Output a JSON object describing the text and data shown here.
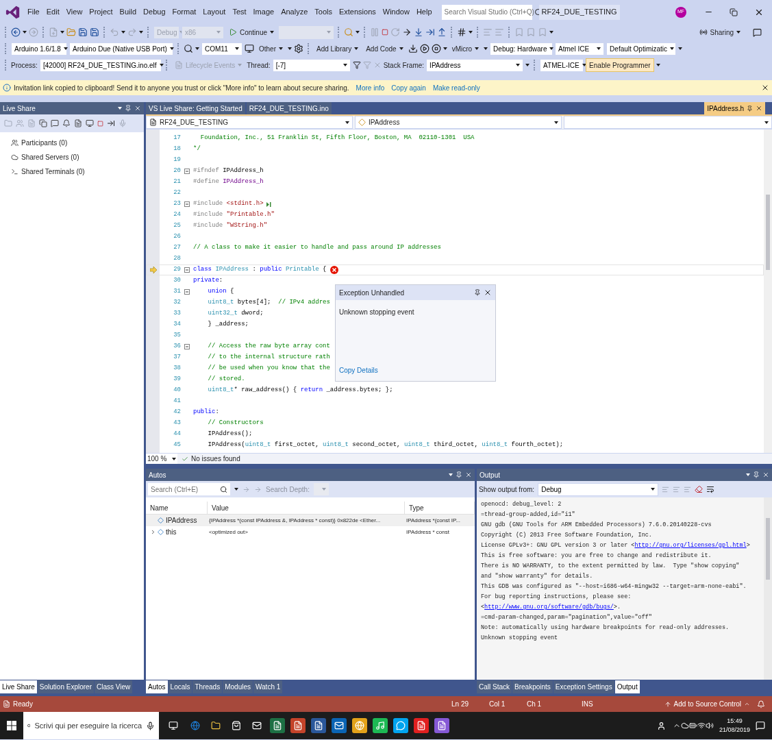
{
  "menu": {
    "items": [
      "File",
      "Edit",
      "View",
      "Project",
      "Build",
      "Debug",
      "Format",
      "Layout",
      "Test",
      "Image",
      "Analyze",
      "Tools",
      "Extensions",
      "Window",
      "Help"
    ],
    "search_placeholder": "Search Visual Studio (Ctrl+Q)",
    "solution_name": "RF24_DUE_TESTING",
    "avatar": "MF"
  },
  "toolbar_1": {
    "configuration": {
      "text": "Debug",
      "disabled": true
    },
    "platform": {
      "text": "x86",
      "disabled": true
    },
    "continue": "Continue",
    "sharing": "Sharing"
  },
  "toolbar_2": {
    "board_version": "Arduino 1.6/1.8",
    "board": "Arduino Due (Native USB Port)",
    "port": "COM11",
    "other": "Other",
    "add_library": "Add Library",
    "add_code": "Add Code",
    "vmicro": "vMicro",
    "debug_mode": "Debug: Hardware",
    "programmer": "Atmel ICE",
    "optimization": "Default Optimizatic"
  },
  "toolbar_3": {
    "process_label": "Process:",
    "process": "[42000] RF24_DUE_TESTING.ino.elf",
    "lifecycle_events": "Lifecycle Events",
    "thread_label": "Thread:",
    "thread": "[-7]",
    "stack_frame_label": "Stack Frame:",
    "stack_frame": "IPAddress",
    "debugger": "ATMEL-ICE",
    "enable_programmer": "Enable Programmer"
  },
  "info_bar": {
    "message": "Invitation link copied to clipboard! Send it to anyone you trust or click \"More info\" to learn about secure sharing.",
    "links": [
      "More info",
      "Copy again",
      "Make read-only"
    ]
  },
  "live_share": {
    "title": "Live Share",
    "items": [
      "Participants (0)",
      "Shared Servers (0)",
      "Shared Terminals (0)"
    ],
    "tabs": [
      {
        "label": "Live Share",
        "selected": true
      },
      {
        "label": "Solution Explorer",
        "selected": false
      },
      {
        "label": "Class View",
        "selected": false
      }
    ]
  },
  "editor": {
    "tabs": [
      {
        "label": "VS Live Share: Getting Started",
        "selected": false
      },
      {
        "label": "RF24_DUE_TESTING.ino",
        "selected": false
      },
      {
        "label": "IPAddress.h",
        "selected": true
      }
    ],
    "project_dropdown": "RF24_DUE_TESTING",
    "member_dropdown": "IPAddress",
    "lines": [
      {
        "number": "17",
        "fold": false,
        "current": false,
        "run_marker": false,
        "tokens": [
          {
            "text": "  Foundation, Inc., 51 Franklin St, Fifth Floor, Boston, MA  02110-1301  USA",
            "kind": "comment"
          }
        ]
      },
      {
        "number": "18",
        "fold": false,
        "current": false,
        "run_marker": false,
        "tokens": [
          {
            "text": "*/",
            "kind": "comment"
          }
        ]
      },
      {
        "number": "19",
        "fold": false,
        "current": false,
        "run_marker": false
      },
      {
        "number": "20",
        "fold": true,
        "current": false,
        "run_marker": false,
        "tokens": [
          {
            "text": "#ifndef",
            "kind": "preproc"
          },
          {
            "text": " IPAddress_h",
            "kind": "plain"
          }
        ]
      },
      {
        "number": "21",
        "fold": false,
        "current": false,
        "run_marker": false,
        "tokens": [
          {
            "text": "#define",
            "kind": "preproc"
          },
          {
            "text": " IPAddress_h",
            "kind": "macro"
          }
        ]
      },
      {
        "number": "22",
        "fold": false,
        "current": false,
        "run_marker": false
      },
      {
        "number": "23",
        "fold": true,
        "current": false,
        "run_marker": true,
        "tokens": [
          {
            "text": "#include",
            "kind": "preproc"
          },
          {
            "text": " <stdint.h>",
            "kind": "string"
          }
        ]
      },
      {
        "number": "24",
        "fold": false,
        "current": false,
        "run_marker": false,
        "tokens": [
          {
            "text": "#include",
            "kind": "preproc"
          },
          {
            "text": " \"Printable.h\"",
            "kind": "string"
          }
        ]
      },
      {
        "number": "25",
        "fold": false,
        "current": false,
        "run_marker": false,
        "tokens": [
          {
            "text": "#include",
            "kind": "preproc"
          },
          {
            "text": " \"WString.h\"",
            "kind": "string"
          }
        ]
      },
      {
        "number": "26",
        "fold": false,
        "current": false,
        "run_marker": false
      },
      {
        "number": "27",
        "fold": false,
        "current": false,
        "run_marker": false,
        "tokens": [
          {
            "text": "// A class to make it easier to handle and pass around IP addresses",
            "kind": "comment"
          }
        ]
      },
      {
        "number": "28",
        "fold": false,
        "current": false,
        "run_marker": false
      },
      {
        "number": "29",
        "fold": true,
        "current": true,
        "run_marker": false,
        "tokens": [
          {
            "text": "class",
            "kind": "keyword"
          },
          {
            "text": " IPAddress",
            "kind": "type"
          },
          {
            "text": " : ",
            "kind": "plain"
          },
          {
            "text": "public",
            "kind": "keyword"
          },
          {
            "text": " Printable",
            "kind": "type"
          },
          {
            "text": " {",
            "kind": "plain"
          }
        ]
      },
      {
        "number": "30",
        "fold": false,
        "current": false,
        "run_marker": false,
        "tokens": [
          {
            "text": "private",
            "kind": "keyword"
          },
          {
            "text": ":",
            "kind": "plain"
          }
        ]
      },
      {
        "number": "31",
        "fold": true,
        "current": false,
        "run_marker": false,
        "tokens": [
          {
            "text": "    union",
            "kind": "keyword"
          },
          {
            "text": " {",
            "kind": "plain"
          }
        ]
      },
      {
        "number": "32",
        "fold": false,
        "current": false,
        "run_marker": false,
        "tokens": [
          {
            "text": "    uint8_t",
            "kind": "type"
          },
          {
            "text": " bytes[4];  ",
            "kind": "plain"
          },
          {
            "text": "// IPv4 addres",
            "kind": "comment"
          }
        ]
      },
      {
        "number": "33",
        "fold": false,
        "current": false,
        "run_marker": false,
        "tokens": [
          {
            "text": "    uint32_t",
            "kind": "type"
          },
          {
            "text": " dword;",
            "kind": "plain"
          }
        ]
      },
      {
        "number": "34",
        "fold": false,
        "current": false,
        "run_marker": false,
        "tokens": [
          {
            "text": "    } _address;",
            "kind": "plain"
          }
        ]
      },
      {
        "number": "35",
        "fold": false,
        "current": false,
        "run_marker": false
      },
      {
        "number": "36",
        "fold": true,
        "current": false,
        "run_marker": false,
        "tokens": [
          {
            "text": "    // Access the raw byte array cont",
            "kind": "comment"
          }
        ]
      },
      {
        "number": "37",
        "fold": false,
        "current": false,
        "run_marker": false,
        "tokens": [
          {
            "text": "    // to the internal structure rath",
            "kind": "comment"
          }
        ]
      },
      {
        "number": "38",
        "fold": false,
        "current": false,
        "run_marker": false,
        "tokens": [
          {
            "text": "    // be used when you know that the",
            "kind": "comment"
          }
        ]
      },
      {
        "number": "39",
        "fold": false,
        "current": false,
        "run_marker": false,
        "tokens": [
          {
            "text": "    // stored.",
            "kind": "comment"
          }
        ]
      },
      {
        "number": "40",
        "fold": false,
        "current": false,
        "run_marker": false,
        "tokens": [
          {
            "text": "    uint8_t",
            "kind": "type"
          },
          {
            "text": "* raw_address() { ",
            "kind": "plain"
          },
          {
            "text": "return",
            "kind": "keyword"
          },
          {
            "text": " _address.bytes; };",
            "kind": "plain"
          }
        ]
      },
      {
        "number": "41",
        "fold": false,
        "current": false,
        "run_marker": false
      },
      {
        "number": "42",
        "fold": false,
        "current": false,
        "run_marker": false,
        "tokens": [
          {
            "text": "public",
            "kind": "keyword"
          },
          {
            "text": ":",
            "kind": "plain"
          }
        ]
      },
      {
        "number": "43",
        "fold": false,
        "current": false,
        "run_marker": false,
        "tokens": [
          {
            "text": "    // Constructors",
            "kind": "comment"
          }
        ]
      },
      {
        "number": "44",
        "fold": false,
        "current": false,
        "run_marker": false,
        "tokens": [
          {
            "text": "    IPAddress();",
            "kind": "plain"
          }
        ]
      },
      {
        "number": "45",
        "fold": false,
        "current": false,
        "run_marker": false,
        "tokens": [
          {
            "text": "    IPAddress(",
            "kind": "plain"
          },
          {
            "text": "uint8_t",
            "kind": "type"
          },
          {
            "text": " first_octet, ",
            "kind": "plain"
          },
          {
            "text": "uint8_t",
            "kind": "type"
          },
          {
            "text": " second_octet, ",
            "kind": "plain"
          },
          {
            "text": "uint8_t",
            "kind": "type"
          },
          {
            "text": " third_octet, ",
            "kind": "plain"
          },
          {
            "text": "uint8_t",
            "kind": "type"
          },
          {
            "text": " fourth_octet);",
            "kind": "plain"
          }
        ]
      }
    ],
    "exception": {
      "title": "Exception Unhandled",
      "message": "Unknown stopping event",
      "link": "Copy Details"
    },
    "zoom": "100 %",
    "issues": "No issues found"
  },
  "autos": {
    "title": "Autos",
    "search_placeholder": "Search (Ctrl+E)",
    "search_depth_label": "Search Depth:",
    "columns": [
      "Name",
      "Value",
      "Type"
    ],
    "rows": [
      {
        "name": "IPAddress",
        "value": "{IPAddress *(const IPAddress &, IPAddress * const)} 0x822de <Ether...",
        "type": "IPAddress *(const IP...",
        "expandable": false
      },
      {
        "name": "this",
        "value": "<optimized out>",
        "type": "IPAddress * const",
        "expandable": true
      }
    ],
    "tabs": [
      {
        "label": "Autos",
        "selected": true
      },
      {
        "label": "Locals",
        "selected": false
      },
      {
        "label": "Threads",
        "selected": false
      },
      {
        "label": "Modules",
        "selected": false
      },
      {
        "label": "Watch 1",
        "selected": false
      }
    ]
  },
  "output": {
    "title": "Output",
    "show_from_label": "Show output from:",
    "source": "Debug",
    "lines": [
      {
        "text": "openocd: debug_level: 2"
      },
      {
        "text": "=thread-group-added,id=\"i1\""
      },
      {
        "text": "GNU gdb (GNU Tools for ARM Embedded Processors) 7.6.0.20140228-cvs"
      },
      {
        "text": "Copyright (C) 2013 Free Software Foundation, Inc."
      },
      {
        "text": "License GPLv3+: GNU GPL version 3 or later <",
        "link": "http://gnu.org/licenses/gpl.html",
        "after": ">"
      },
      {
        "text": "This is free software: you are free to change and redistribute it."
      },
      {
        "text": "There is NO WARRANTY, to the extent permitted by law.  Type \"show copying\""
      },
      {
        "text": "and \"show warranty\" for details."
      },
      {
        "text": "This GDB was configured as \"--host=i686-w64-mingw32 --target=arm-none-eabi\"."
      },
      {
        "text": "For bug reporting instructions, please see:"
      },
      {
        "text": "<",
        "link": "http://www.gnu.org/software/gdb/bugs/",
        "after": ">."
      },
      {
        "text": "=cmd-param-changed,param=\"pagination\",value=\"off\""
      },
      {
        "text": "Note: automatically using hardware breakpoints for read-only addresses."
      },
      {
        "text": "Unknown stopping event"
      }
    ],
    "tabs": [
      {
        "label": "Call Stack",
        "selected": false
      },
      {
        "label": "Breakpoints",
        "selected": false
      },
      {
        "label": "Exception Settings",
        "selected": false
      },
      {
        "label": "Output",
        "selected": true
      }
    ]
  },
  "status_bar": {
    "state": "Ready",
    "line": "Ln 29",
    "column": "Col 1",
    "char": "Ch 1",
    "mode": "INS",
    "source_control": "Add to Source Control"
  },
  "taskbar": {
    "search_placeholder": "Scrivi qui per eseguire la ricerca",
    "time": "15:49",
    "date": "21/08/2019"
  }
}
